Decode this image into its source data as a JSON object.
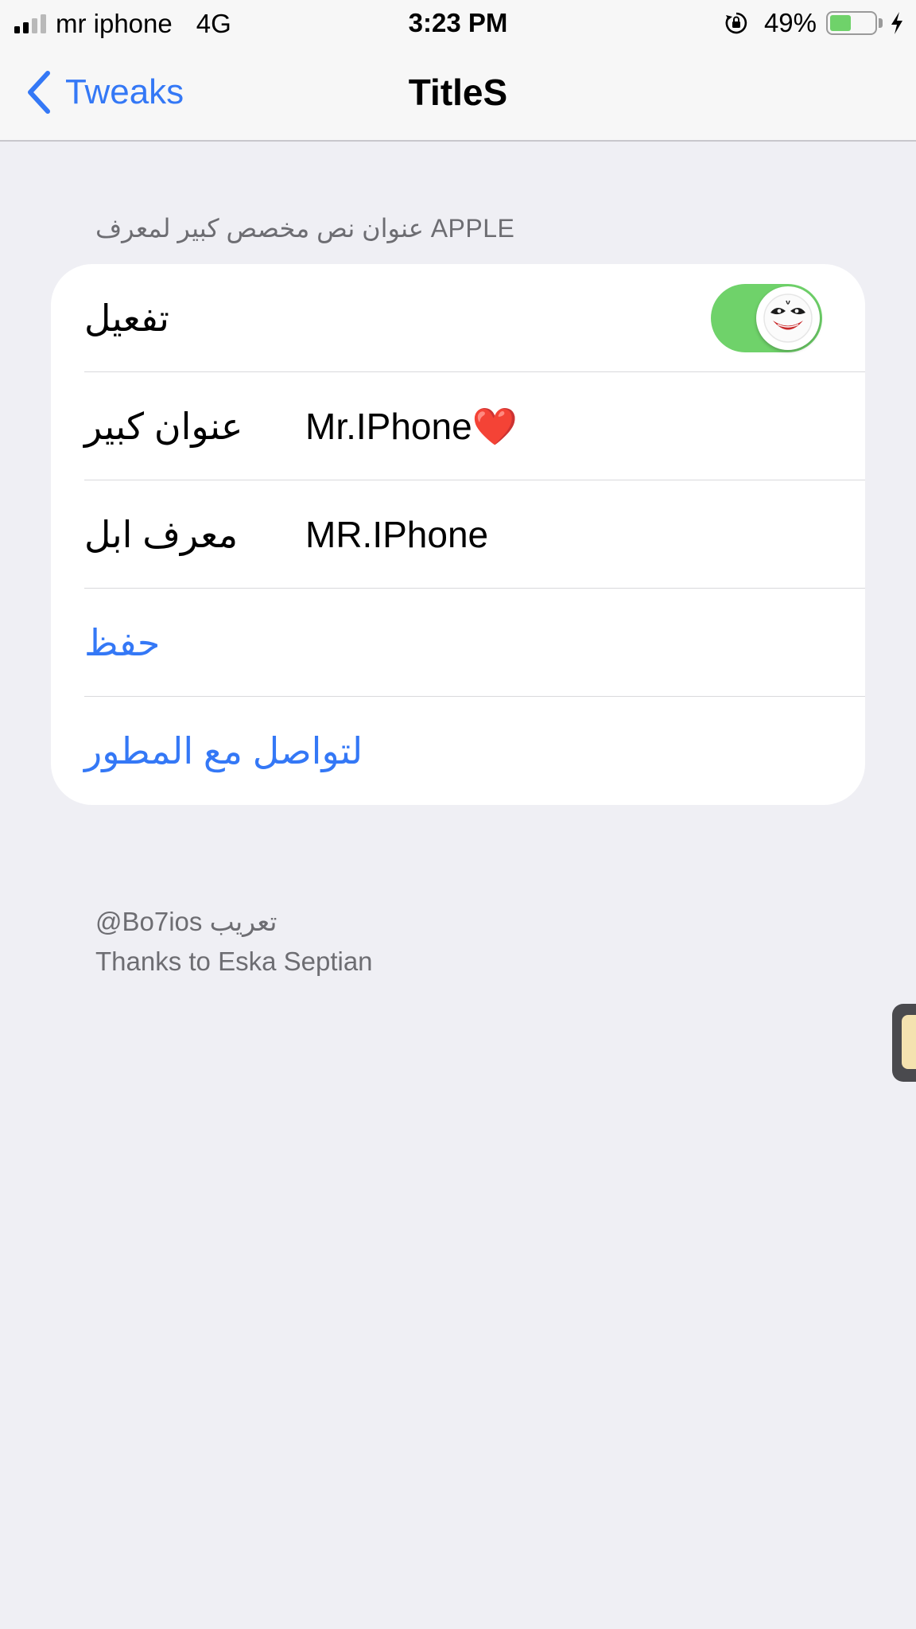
{
  "status_bar": {
    "carrier": "mr iphone",
    "network": "4G",
    "time": "3:23 PM",
    "battery_percent": "49%",
    "battery_level": 0.49,
    "icons": [
      "signal-icon",
      "rotation-lock-icon",
      "battery-icon",
      "charging-bolt-icon"
    ]
  },
  "nav": {
    "back_label": "Tweaks",
    "title": "TitleS"
  },
  "group_header": "عنوان نص مخصص كبير لمعرف APPLE",
  "rows": {
    "enable_label": "تفعيل",
    "enable_on": true,
    "big_title_label": "عنوان كبير",
    "big_title_value": "Mr.IPhone❤️",
    "apple_id_label": "معرف ابل",
    "apple_id_value": "MR.IPhone",
    "save_label": "حفظ",
    "contact_label": "لتواصل مع المطور"
  },
  "footer": {
    "line1": "@Bo7ios تعريب",
    "line2": "Thanks to Eska Septian"
  },
  "colors": {
    "accent": "#3478f6",
    "toggle_on": "#6fd26a",
    "background": "#efeff4"
  }
}
